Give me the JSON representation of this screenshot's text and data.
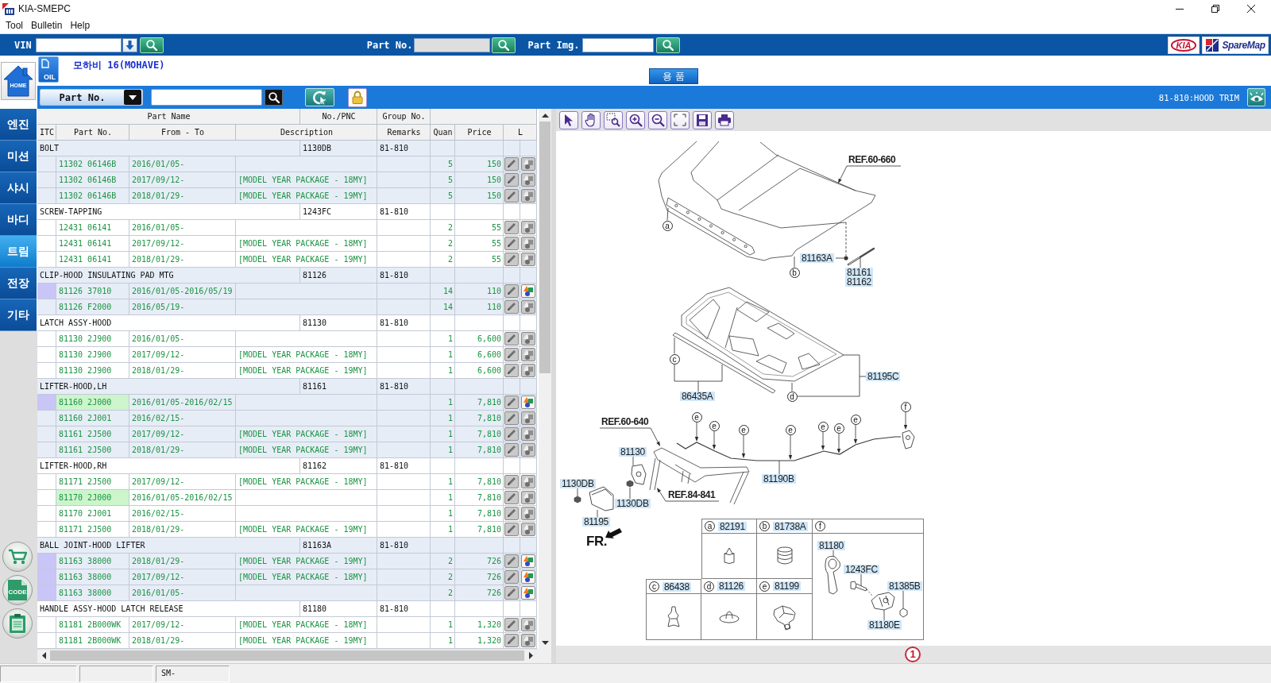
{
  "window": {
    "title": "KIA-SMEPC"
  },
  "menu": [
    "Tool",
    "Bulletin",
    "Help"
  ],
  "search_bar": {
    "vin_label": "VIN",
    "part_no_label": "Part No.",
    "part_img_label": "Part Img.",
    "logos": [
      "KIA",
      "SpareMap"
    ]
  },
  "header": {
    "home_label": "HOME",
    "oil_label": "OIL",
    "model": "모하비 16(MOHAVE)",
    "category_button": "용 품"
  },
  "toolbar": {
    "search_mode": "Part No.",
    "section": "81-810:HOOD TRIM"
  },
  "sidebar": {
    "tabs": [
      {
        "label": "엔진",
        "selected": false
      },
      {
        "label": "미션",
        "selected": false
      },
      {
        "label": "샤시",
        "selected": false
      },
      {
        "label": "바디",
        "selected": false
      },
      {
        "label": "트림",
        "selected": true
      },
      {
        "label": "전장",
        "selected": false
      },
      {
        "label": "기타",
        "selected": false
      }
    ],
    "tools": [
      {
        "kind": "cart"
      },
      {
        "kind": "code",
        "label": "CODE"
      },
      {
        "kind": "clipboard"
      }
    ]
  },
  "parts_table": {
    "header_top": [
      "Part Name",
      "No./PNC",
      "Group No."
    ],
    "columns": [
      "ITC",
      "Part No.",
      "From - To",
      "Description",
      "Remarks",
      "Quan",
      "Price",
      "L"
    ],
    "groups": [
      {
        "name": "BOLT",
        "pnc": "1130DB",
        "group_no": "81-810",
        "parts": [
          {
            "part_no": "11302 06146B",
            "from_to": "2016/01/05-",
            "quantity": "5",
            "price": "150",
            "itc_flag": false,
            "highlighted": false,
            "image_colored": false
          },
          {
            "part_no": "11302 06146B",
            "from_to": "2017/09/12-",
            "description": "[MODEL YEAR PACKAGE - 18MY]",
            "quantity": "5",
            "price": "150",
            "itc_flag": false,
            "highlighted": false,
            "image_colored": false
          },
          {
            "part_no": "11302 06146B",
            "from_to": "2018/01/29-",
            "description": "[MODEL YEAR PACKAGE - 19MY]",
            "quantity": "5",
            "price": "150",
            "itc_flag": false,
            "highlighted": false,
            "image_colored": false
          }
        ]
      },
      {
        "name": "SCREW-TAPPING",
        "pnc": "1243FC",
        "group_no": "81-810",
        "parts": [
          {
            "part_no": "12431 06141",
            "from_to": "2016/01/05-",
            "quantity": "2",
            "price": "55",
            "itc_flag": false,
            "highlighted": false,
            "image_colored": false
          },
          {
            "part_no": "12431 06141",
            "from_to": "2017/09/12-",
            "description": "[MODEL YEAR PACKAGE - 18MY]",
            "quantity": "2",
            "price": "55",
            "itc_flag": false,
            "highlighted": false,
            "image_colored": false
          },
          {
            "part_no": "12431 06141",
            "from_to": "2018/01/29-",
            "description": "[MODEL YEAR PACKAGE - 19MY]",
            "quantity": "2",
            "price": "55",
            "itc_flag": false,
            "highlighted": false,
            "image_colored": false
          }
        ]
      },
      {
        "name": "CLIP-HOOD INSULATING PAD MTG",
        "pnc": "81126",
        "group_no": "81-810",
        "parts": [
          {
            "part_no": "81126 37010",
            "from_to": "2016/01/05-2016/05/19",
            "quantity": "14",
            "price": "110",
            "itc_flag": true,
            "highlighted": false,
            "image_colored": true
          },
          {
            "part_no": "81126 F2000",
            "from_to": "2016/05/19-",
            "quantity": "14",
            "price": "110",
            "itc_flag": false,
            "highlighted": false,
            "image_colored": false
          }
        ]
      },
      {
        "name": "LATCH ASSY-HOOD",
        "pnc": "81130",
        "group_no": "81-810",
        "parts": [
          {
            "part_no": "81130 2J900",
            "from_to": "2016/01/05-",
            "quantity": "1",
            "price": "6,600",
            "itc_flag": false,
            "highlighted": false,
            "image_colored": false
          },
          {
            "part_no": "81130 2J900",
            "from_to": "2017/09/12-",
            "description": "[MODEL YEAR PACKAGE - 18MY]",
            "quantity": "1",
            "price": "6,600",
            "itc_flag": false,
            "highlighted": false,
            "image_colored": false
          },
          {
            "part_no": "81130 2J900",
            "from_to": "2018/01/29-",
            "description": "[MODEL YEAR PACKAGE - 19MY]",
            "quantity": "1",
            "price": "6,600",
            "itc_flag": false,
            "highlighted": false,
            "image_colored": false
          }
        ]
      },
      {
        "name": "LIFTER-HOOD,LH",
        "pnc": "81161",
        "group_no": "81-810",
        "parts": [
          {
            "part_no": "81160 2J000",
            "from_to": "2016/01/05-2016/02/15",
            "quantity": "1",
            "price": "7,810",
            "itc_flag": true,
            "highlighted": true,
            "image_colored": true
          },
          {
            "part_no": "81160 2J001",
            "from_to": "2016/02/15-",
            "quantity": "1",
            "price": "7,810",
            "itc_flag": false,
            "highlighted": false,
            "image_colored": false
          },
          {
            "part_no": "81161 2J500",
            "from_to": "2017/09/12-",
            "description": "[MODEL YEAR PACKAGE - 18MY]",
            "quantity": "1",
            "price": "7,810",
            "itc_flag": false,
            "highlighted": false,
            "image_colored": false
          },
          {
            "part_no": "81161 2J500",
            "from_to": "2018/01/29-",
            "description": "[MODEL YEAR PACKAGE - 19MY]",
            "quantity": "1",
            "price": "7,810",
            "itc_flag": false,
            "highlighted": false,
            "image_colored": false
          }
        ]
      },
      {
        "name": "LIFTER-HOOD,RH",
        "pnc": "81162",
        "group_no": "81-810",
        "parts": [
          {
            "part_no": "81171 2J500",
            "from_to": "2017/09/12-",
            "description": "[MODEL YEAR PACKAGE - 18MY]",
            "quantity": "1",
            "price": "7,810",
            "itc_flag": false,
            "highlighted": false,
            "image_colored": false
          },
          {
            "part_no": "81170 2J000",
            "from_to": "2016/01/05-2016/02/15",
            "quantity": "1",
            "price": "7,810",
            "itc_flag": false,
            "highlighted": true,
            "image_colored": false
          },
          {
            "part_no": "81170 2J001",
            "from_to": "2016/02/15-",
            "quantity": "1",
            "price": "7,810",
            "itc_flag": false,
            "highlighted": false,
            "image_colored": false
          },
          {
            "part_no": "81171 2J500",
            "from_to": "2018/01/29-",
            "description": "[MODEL YEAR PACKAGE - 19MY]",
            "quantity": "1",
            "price": "7,810",
            "itc_flag": false,
            "highlighted": false,
            "image_colored": false
          }
        ]
      },
      {
        "name": "BALL JOINT-HOOD LIFTER",
        "pnc": "81163A",
        "group_no": "81-810",
        "parts": [
          {
            "part_no": "81163 38000",
            "from_to": "2018/01/29-",
            "description": "[MODEL YEAR PACKAGE - 19MY]",
            "quantity": "2",
            "price": "726",
            "itc_flag": true,
            "highlighted": false,
            "image_colored": true
          },
          {
            "part_no": "81163 38000",
            "from_to": "2017/09/12-",
            "description": "[MODEL YEAR PACKAGE - 18MY]",
            "quantity": "2",
            "price": "726",
            "itc_flag": true,
            "highlighted": false,
            "image_colored": true
          },
          {
            "part_no": "81163 38000",
            "from_to": "2016/01/05-",
            "quantity": "2",
            "price": "726",
            "itc_flag": true,
            "highlighted": false,
            "image_colored": true
          }
        ]
      },
      {
        "name": "HANDLE ASSY-HOOD LATCH RELEASE",
        "pnc": "81180",
        "group_no": "81-810",
        "parts": [
          {
            "part_no": "81181 2B000WK",
            "from_to": "2017/09/12-",
            "description": "[MODEL YEAR PACKAGE - 18MY]",
            "quantity": "1",
            "price": "1,320",
            "itc_flag": false,
            "highlighted": false,
            "image_colored": false
          },
          {
            "part_no": "81181 2B000WK",
            "from_to": "2018/01/29-",
            "description": "[MODEL YEAR PACKAGE - 19MY]",
            "quantity": "1",
            "price": "1,320",
            "itc_flag": false,
            "highlighted": false,
            "image_colored": false
          }
        ]
      }
    ]
  },
  "diagram": {
    "labels": [
      {
        "kind": "ref",
        "text": "REF.60-660"
      },
      {
        "kind": "callout",
        "text": "a"
      },
      {
        "kind": "part",
        "text": "81163A"
      },
      {
        "kind": "callout",
        "text": "b"
      },
      {
        "kind": "part",
        "text": "81161"
      },
      {
        "kind": "part",
        "text": "81162"
      },
      {
        "kind": "callout",
        "text": "c"
      },
      {
        "kind": "part",
        "text": "81195C"
      },
      {
        "kind": "part",
        "text": "86435A"
      },
      {
        "kind": "callout",
        "text": "d"
      },
      {
        "kind": "callout",
        "text": "f"
      },
      {
        "kind": "ref",
        "text": "REF.60-640"
      },
      {
        "kind": "callout",
        "text": "e"
      },
      {
        "kind": "callout",
        "text": "e"
      },
      {
        "kind": "callout",
        "text": "e"
      },
      {
        "kind": "callout",
        "text": "e"
      },
      {
        "kind": "callout",
        "text": "e"
      },
      {
        "kind": "callout",
        "text": "e"
      },
      {
        "kind": "callout",
        "text": "e"
      },
      {
        "kind": "part",
        "text": "81130"
      },
      {
        "kind": "part",
        "text": "81190B"
      },
      {
        "kind": "part",
        "text": "1130DB"
      },
      {
        "kind": "ref",
        "text": "REF.84-841"
      },
      {
        "kind": "part",
        "text": "1130DB"
      },
      {
        "kind": "part",
        "text": "81195"
      },
      {
        "kind": "direction",
        "text": "FR."
      }
    ],
    "legend": {
      "cells": [
        {
          "letter": "a",
          "part": "82191"
        },
        {
          "letter": "b",
          "part": "81738A"
        },
        {
          "letter": "c",
          "part": "86438"
        },
        {
          "letter": "d",
          "part": "81126"
        },
        {
          "letter": "e",
          "part": "81199"
        }
      ],
      "group": {
        "letter": "f",
        "parts": [
          "81180",
          "1243FC",
          "81385B",
          "81180E"
        ]
      }
    },
    "page": "1"
  },
  "status_bar": {
    "text": "SM-"
  }
}
